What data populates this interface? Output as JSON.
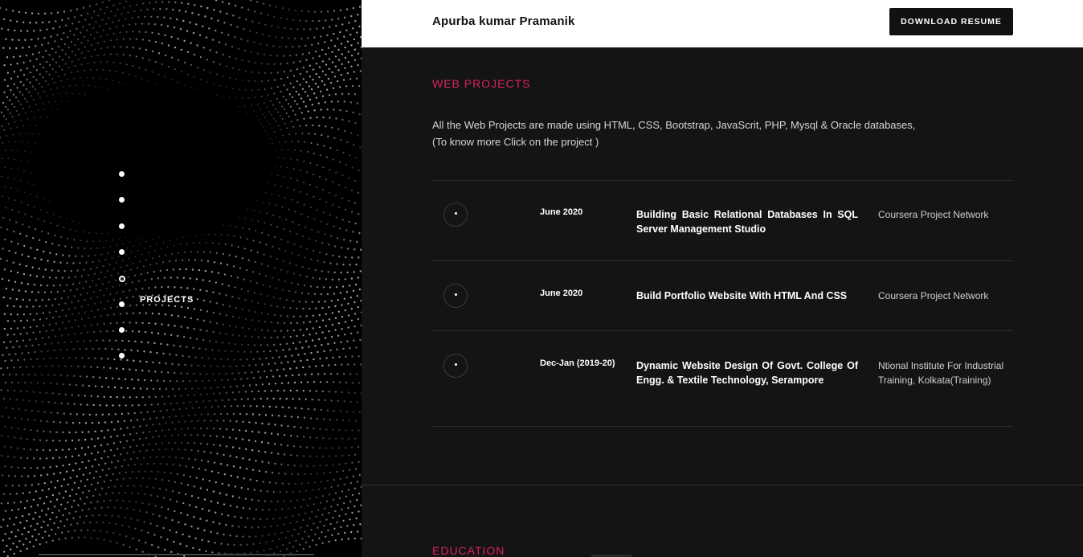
{
  "header": {
    "brand": "Apurba kumar Pramanik",
    "resume_button": "DOWNLOAD RESUME"
  },
  "sidebar": {
    "active_label": "PROJECTS",
    "dots_count": 8,
    "active_index": 4
  },
  "web_projects": {
    "title": "WEB PROJECTS",
    "intro_line1": "All the Web Projects are made using HTML, CSS, Bootstrap, JavaScrit, PHP, Mysql & Oracle databases,",
    "intro_line2": "(To know more Click on the project )",
    "items": [
      {
        "date": "June 2020",
        "title": "Building Basic Relational Databases In SQL Server Management Studio",
        "org": "Coursera Project Network"
      },
      {
        "date": "June 2020",
        "title": "Build Portfolio Website With HTML And CSS",
        "org": "Coursera Project Network"
      },
      {
        "date": "Dec-Jan (2019-20)",
        "title": "Dynamic Website Design Of Govt. College Of Engg. & Textile Technology, Serampore",
        "org": "Ntional Institute For Industrial Training, Kolkata(Training)"
      }
    ]
  },
  "education": {
    "title": "EDUCATION"
  },
  "colors": {
    "accent": "#d9245e",
    "panel_bg": "#141414",
    "topbar_bg": "#ffffff"
  }
}
